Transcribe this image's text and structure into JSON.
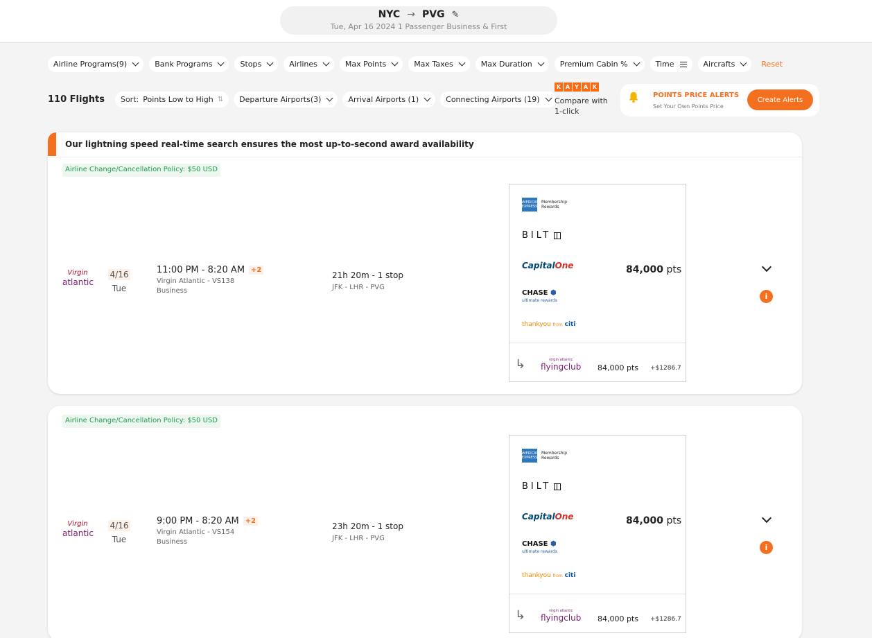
{
  "header": {
    "origin": "NYC",
    "destination": "PVG",
    "subtitle": "Tue, Apr 16 2024   1 Passenger   Business & First"
  },
  "filters": [
    {
      "label": "Airline Programs(9)"
    },
    {
      "label": "Bank Programs"
    },
    {
      "label": "Stops"
    },
    {
      "label": "Airlines"
    },
    {
      "label": "Max Points"
    },
    {
      "label": "Max Taxes"
    },
    {
      "label": "Max Duration"
    },
    {
      "label": "Premium Cabin %"
    },
    {
      "label": "Time"
    },
    {
      "label": "Aircrafts"
    }
  ],
  "reset_label": "Reset",
  "results": {
    "count_label": "110 Flights",
    "sort_prefix": "Sort:",
    "sort_value": "Points Low to High",
    "airport_filters": [
      {
        "label": "Departure Airports(3)"
      },
      {
        "label": "Arrival Airports (1)"
      },
      {
        "label": "Connecting Airports (19)"
      }
    ]
  },
  "kayak": {
    "letters": [
      "K",
      "A",
      "Y",
      "A",
      "K"
    ],
    "text": "Compare with 1-click"
  },
  "alerts": {
    "title": "POINTS PRICE ALERTS",
    "subtitle": "Set Your Own Points Price",
    "button": "Create Alerts"
  },
  "banner": "Our lightning speed real-time search ensures the most up-to-second award availability",
  "bank_logos": {
    "amex_square": "AMERICAN EXPRESS",
    "amex_line1": "Membership",
    "amex_line2": "Rewards",
    "bilt": "BILT",
    "capital": "Capital",
    "one": "One",
    "chase": "CHASE",
    "chase_sub": "ultimate rewards",
    "citi_thank": "thankyou",
    "citi_from": "from",
    "citi_name": "citi"
  },
  "airline_logo": {
    "mark": "Virgin",
    "word": "atlantic"
  },
  "program_logo": {
    "small": "virgin atlantic",
    "word": "flyingclub"
  },
  "flights": [
    {
      "policy": "Airline Change/Cancellation Policy: $50 USD",
      "date": "4/16",
      "day": "Tue",
      "time": "11:00 PM - 8:20 AM",
      "plus": "+2",
      "flight": "Virgin Atlantic - VS138",
      "cabin": "Business",
      "duration": "21h 20m - 1 stop",
      "route": "JFK - LHR - PVG",
      "points": "84,000",
      "points_unit": "pts",
      "program_points": "84,000 pts",
      "program_tax": "+$1286.7"
    },
    {
      "policy": "Airline Change/Cancellation Policy: $50 USD",
      "date": "4/16",
      "day": "Tue",
      "time": "9:00 PM - 8:20 AM",
      "plus": "+2",
      "flight": "Virgin Atlantic - VS154",
      "cabin": "Business",
      "duration": "23h 20m - 1 stop",
      "route": "JFK - LHR - PVG",
      "points": "84,000",
      "points_unit": "pts",
      "program_points": "84,000 pts",
      "program_tax": "+$1286.7"
    }
  ],
  "colors": {
    "accent": "#f37021",
    "policy_green": "#1c9d4c",
    "amex_blue": "#2e77bc"
  }
}
